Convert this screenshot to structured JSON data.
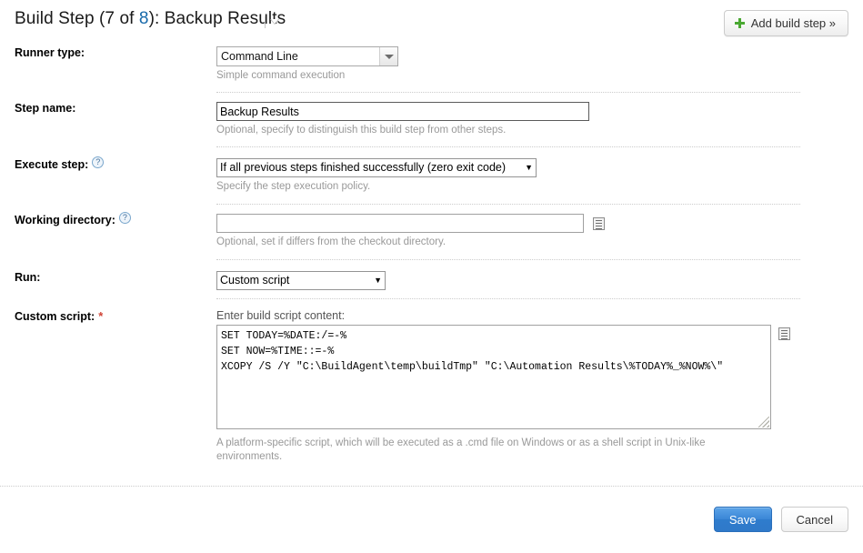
{
  "header": {
    "title_prefix": "Build Step (",
    "step_index": "7",
    "of_text": " of ",
    "step_total": "8",
    "title_suffix": "): Backup Results",
    "menu_caret": "chevron-down-icon",
    "add_step_label": "Add build step »",
    "add_step_plus": "plus-icon"
  },
  "form": {
    "runner_type": {
      "label": "Runner type:",
      "value": "Command Line",
      "hint": "Simple command execution"
    },
    "step_name": {
      "label": "Step name:",
      "value": "Backup Results",
      "placeholder": "",
      "hint": "Optional, specify to distinguish this build step from other steps."
    },
    "execute_step": {
      "label": "Execute step:",
      "help": "?",
      "value": "If all previous steps finished successfully (zero exit code)",
      "arrow": "▼",
      "hint": "Specify the step execution policy."
    },
    "working_directory": {
      "label": "Working directory:",
      "help": "?",
      "value": "",
      "placeholder": "",
      "browse_icon": "browse-icon",
      "hint": "Optional, set if differs from the checkout directory."
    },
    "run": {
      "label": "Run:",
      "value": "Custom script",
      "arrow": "▼"
    },
    "custom_script": {
      "label": "Custom script:",
      "required_marker": "*",
      "field_label": "Enter build script content:",
      "value": "SET TODAY=%DATE:/=-%\nSET NOW=%TIME::=-%\nXCOPY /S /Y \"C:\\BuildAgent\\temp\\buildTmp\" \"C:\\Automation Results\\%TODAY%_%NOW%\\\"",
      "browse_icon": "browse-icon",
      "hint": "A platform-specific script, which will be executed as a .cmd file on Windows or as a shell script in Unix-like environments."
    }
  },
  "footer": {
    "save_label": "Save",
    "cancel_label": "Cancel"
  },
  "colors": {
    "link_blue": "#1769aa",
    "primary_button": "#2f7ccd",
    "required_red": "#d04437",
    "plus_green": "#4aa832",
    "hint_gray": "#999999"
  }
}
